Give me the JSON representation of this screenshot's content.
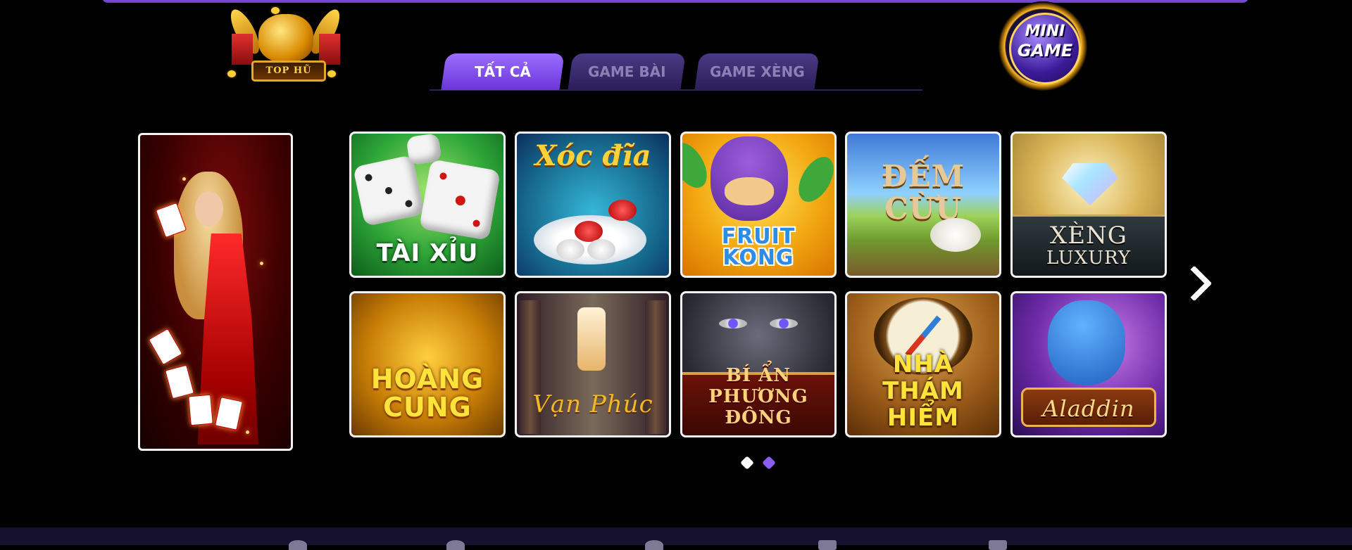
{
  "top_hu": {
    "label": "TOP HŨ"
  },
  "mini_game": {
    "line1": "MINI",
    "line2": "GAME"
  },
  "tabs": [
    {
      "label": "TẤT CẢ",
      "active": true
    },
    {
      "label": "GAME BÀI",
      "active": false
    },
    {
      "label": "GAME XÈNG",
      "active": false
    }
  ],
  "games": {
    "row1": [
      {
        "title": "TÀI XỈU"
      },
      {
        "title": "Xóc đĩa"
      },
      {
        "title_line1": "FRUIT",
        "title_line2": "KONG"
      },
      {
        "title_line1": "ĐẾM",
        "title_line2": "CỪU"
      },
      {
        "title_line1": "XÈNG",
        "title_line2": "LUXURY"
      }
    ],
    "row2": [
      {
        "title_line1": "HOÀNG",
        "title_line2": "CUNG"
      },
      {
        "title": "Vạn Phúc"
      },
      {
        "title_line1": "BÍ ẨN",
        "title_line2": "PHƯƠNG ĐÔNG"
      },
      {
        "title_line1": "NHÀ",
        "title_line2": "THÁM HIỂM"
      },
      {
        "title": "Aladdin"
      }
    ]
  },
  "pagination": {
    "pages": 2,
    "current": 1
  },
  "colors": {
    "accent": "#8b5cf0",
    "background": "#000000",
    "tab_inactive_text": "#8c80b4"
  },
  "icons": {
    "next": "chevron-right-icon"
  }
}
